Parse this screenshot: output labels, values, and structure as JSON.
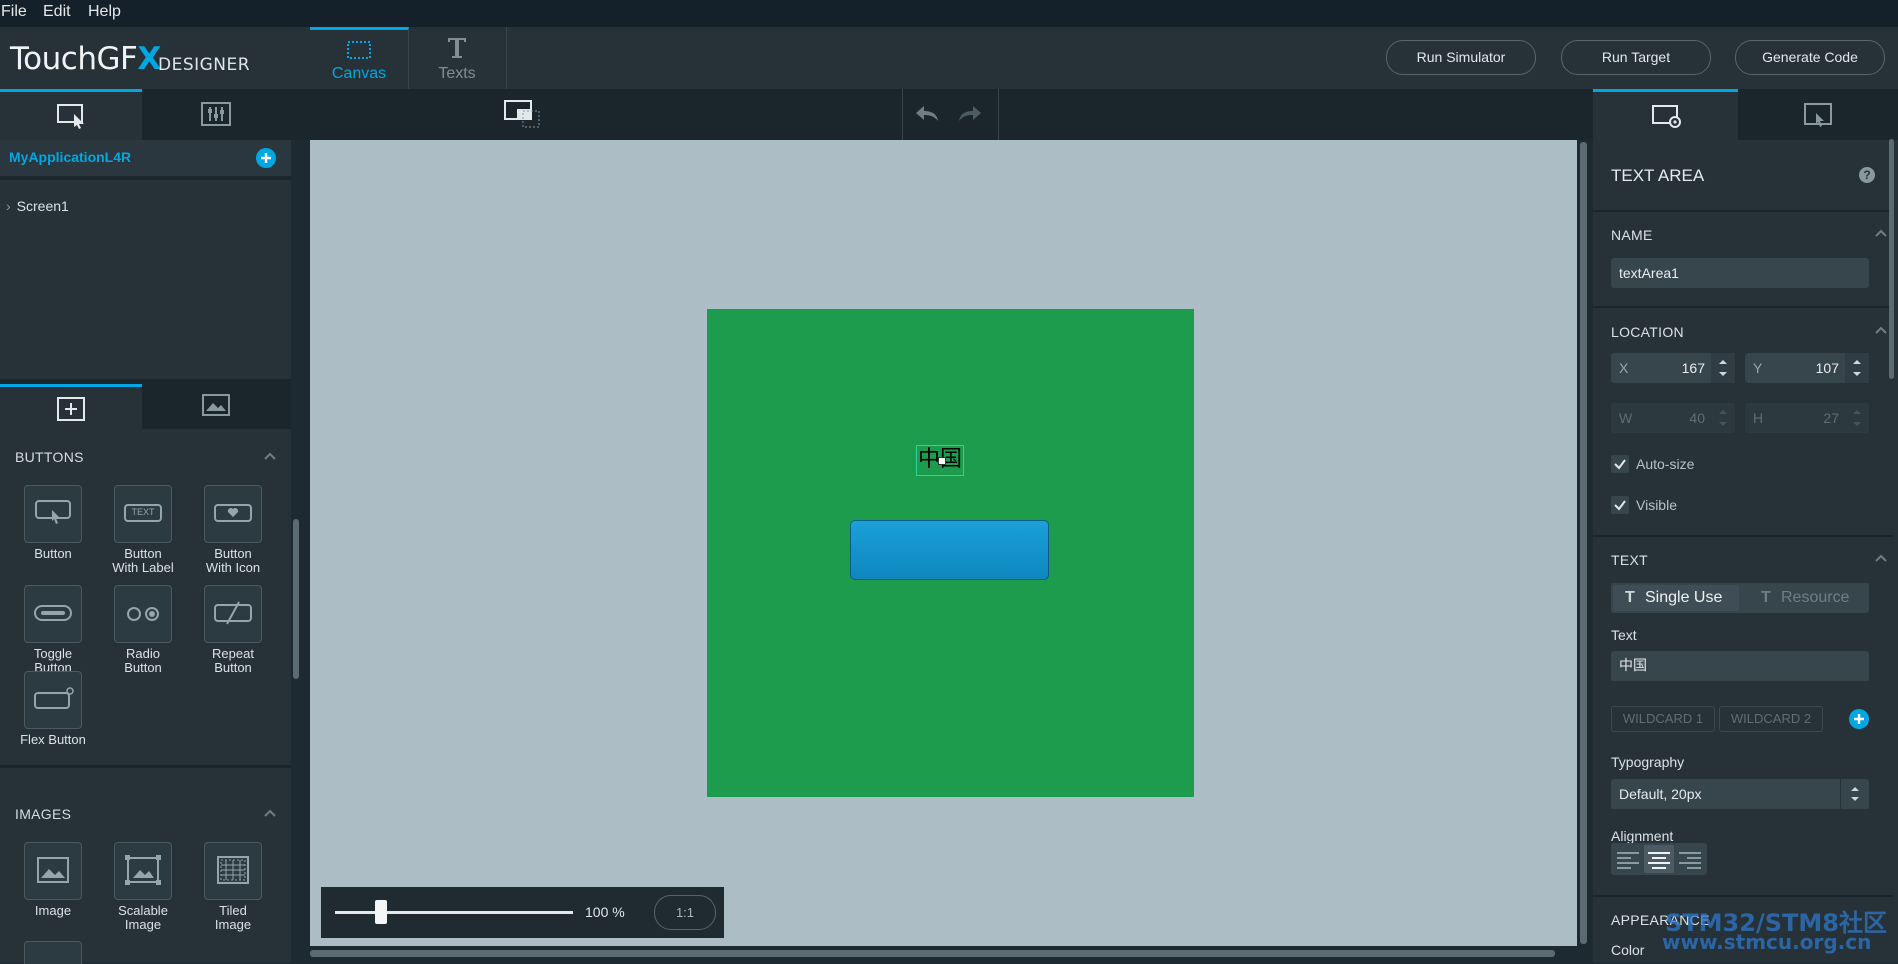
{
  "menu": {
    "file": "File",
    "edit": "Edit",
    "help": "Help"
  },
  "logo": {
    "main_prefix": "TouchGF",
    "main_x": "X",
    "sub": "DESIGNER"
  },
  "top_tabs": {
    "canvas": "Canvas",
    "texts": "Texts"
  },
  "header_buttons": {
    "run_simulator": "Run Simulator",
    "run_target": "Run Target",
    "generate_code": "Generate Code"
  },
  "tree": {
    "app_name": "MyApplicationL4R",
    "screen1": "Screen1"
  },
  "sections": {
    "buttons": "BUTTONS",
    "images": "IMAGES"
  },
  "widgets": {
    "button": "Button",
    "button_with_label_1": "Button",
    "button_with_label_2": "With Label",
    "button_with_icon_1": "Button",
    "button_with_icon_2": "With Icon",
    "toggle_1": "Toggle",
    "toggle_2": "Button",
    "radio_1": "Radio",
    "radio_2": "Button",
    "repeat_1": "Repeat",
    "repeat_2": "Button",
    "flex": "Flex Button",
    "image": "Image",
    "scalable_1": "Scalable",
    "scalable_2": "Image",
    "tiled_1": "Tiled",
    "tiled_2": "Image",
    "text_icon_label": "TEXT"
  },
  "canvas": {
    "text_content": "中国",
    "zoom": "100 %",
    "zoom_value_percent": 100,
    "reset_zoom": "1:1",
    "screen_color": "#1e9c4e",
    "button_color": "#0e87be"
  },
  "props": {
    "title": "TEXT AREA",
    "help": "?",
    "name_header": "NAME",
    "name_value": "textArea1",
    "location_header": "LOCATION",
    "x_label": "X",
    "x_value": "167",
    "y_label": "Y",
    "y_value": "107",
    "w_label": "W",
    "w_value": "40",
    "h_label": "H",
    "h_value": "27",
    "autosize": "Auto-size",
    "visible": "Visible",
    "text_header": "TEXT",
    "single_use": "Single Use",
    "resource": "Resource",
    "text_label": "Text",
    "text_value": "中国",
    "wildcard1": "WILDCARD 1",
    "wildcard2": "WILDCARD 2",
    "typography_label": "Typography",
    "typography_value": "Default, 20px",
    "alignment_label": "Alignment",
    "appearance_header": "APPEARANCE",
    "color_label": "Color"
  },
  "watermark": {
    "line1": "STM32/STM8社区",
    "line2": "www.stmcu.org.cn"
  },
  "colors": {
    "accent": "#00a7e3"
  }
}
